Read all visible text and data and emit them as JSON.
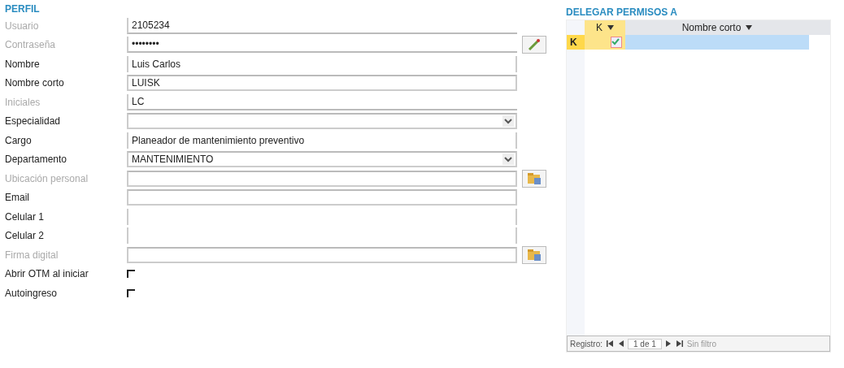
{
  "perfil": {
    "title": "PERFIL",
    "fields": [
      {
        "label": "Usuario",
        "kind": "text",
        "value": "2105234",
        "disabled": true,
        "button": false
      },
      {
        "label": "Contraseña",
        "kind": "password",
        "value": "••••••••",
        "disabled": true,
        "button": true
      },
      {
        "label": "Nombre",
        "kind": "plain",
        "value": "Luis Carlos",
        "disabled": false,
        "button": false
      },
      {
        "label": "Nombre corto",
        "kind": "text",
        "value": "LUISK",
        "disabled": false,
        "button": false
      },
      {
        "label": "Iniciales",
        "kind": "text",
        "value": "LC",
        "disabled": true,
        "button": false
      },
      {
        "label": "Especialidad",
        "kind": "select",
        "disabled": false,
        "button": false
      },
      {
        "label": "Cargo",
        "kind": "plain",
        "value": "Planeador de mantenimiento preventivo",
        "disabled": false,
        "button": false
      },
      {
        "label": "Departamento",
        "kind": "select",
        "value": "MANTENIMIENTO",
        "disabled": false,
        "button": false
      },
      {
        "label": "Ubicación personal",
        "kind": "text",
        "disabled": true,
        "button": true
      },
      {
        "label": "Email",
        "kind": "text",
        "disabled": false,
        "button": false
      },
      {
        "label": "Celular 1",
        "kind": "plain",
        "disabled": false,
        "button": false
      },
      {
        "label": "Celular 2",
        "kind": "plain",
        "disabled": false,
        "button": false
      },
      {
        "label": "Firma digital",
        "kind": "text",
        "disabled": true,
        "button": true
      },
      {
        "label": "Abrir OTM al iniciar",
        "kind": "check",
        "checked": false,
        "disabled": false,
        "button": false
      },
      {
        "label": "Autoingreso",
        "kind": "check",
        "checked": false,
        "disabled": false,
        "button": false
      }
    ]
  },
  "delegar": {
    "title": "DELEGAR PERMISOS A",
    "columns": [
      "K",
      "Nombre corto"
    ],
    "rows": [
      {
        "indicator": "K",
        "checked": true,
        "selected": true
      }
    ],
    "pager": {
      "label": "Registro:",
      "position": "1 de 1",
      "filter": "Sin filtro"
    }
  }
}
